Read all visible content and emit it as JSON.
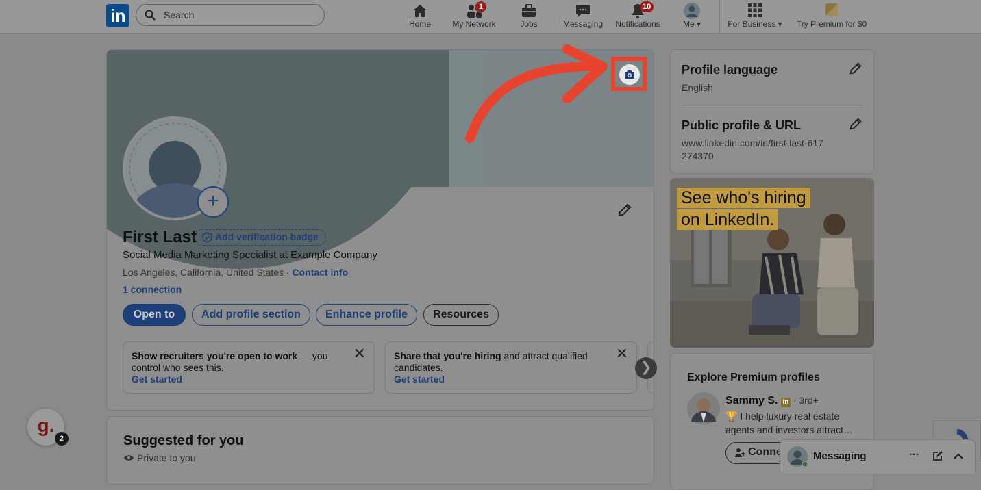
{
  "nav": {
    "logo": "in",
    "search_placeholder": "Search",
    "items": [
      {
        "label": "Home",
        "icon": "home-icon"
      },
      {
        "label": "My Network",
        "icon": "network-icon",
        "badge": "1"
      },
      {
        "label": "Jobs",
        "icon": "briefcase-icon"
      },
      {
        "label": "Messaging",
        "icon": "chat-icon"
      },
      {
        "label": "Notifications",
        "icon": "bell-icon",
        "badge": "10"
      },
      {
        "label": "Me",
        "icon": "avatar-icon"
      },
      {
        "label": "For Business",
        "icon": "grid-icon"
      },
      {
        "label": "Try Premium for $0",
        "icon": "premium-icon"
      }
    ]
  },
  "profile": {
    "name": "First Last",
    "verify_label": "Add verification badge",
    "headline": "Social Media Marketing Specialist at Example Company",
    "location": "Los Angeles, California, United States",
    "location_sep": " · ",
    "contact_info": "Contact info",
    "connections": "1 connection",
    "buttons": {
      "open_to": "Open to",
      "add_section": "Add profile section",
      "enhance": "Enhance profile",
      "resources": "Resources"
    },
    "suggestions": [
      {
        "bold": "Show recruiters you're open to work",
        "rest": " — you control who sees this.",
        "cta": "Get started"
      },
      {
        "bold": "Share that you're hiring",
        "rest": " and attract qualified candidates.",
        "cta": "Get started"
      }
    ],
    "next_arrow": "❯"
  },
  "suggested": {
    "title": "Suggested for you",
    "private": "Private to you"
  },
  "sidebar": {
    "profile_language": {
      "title": "Profile language",
      "value": "English"
    },
    "public_profile": {
      "title": "Public profile & URL",
      "value": "www.linkedin.com/in/first-last-617274370"
    },
    "ad": {
      "line1": "See who's hiring",
      "line2": "on LinkedIn."
    },
    "premium": {
      "title": "Explore Premium profiles",
      "person_name": "Sammy S.",
      "person_degree": " · 3rd+",
      "person_desc": "🏆 I help luxury real estate agents and investors attract…",
      "connect_label": "Conne"
    }
  },
  "widgets": {
    "g_label": "g.",
    "g_badge": "2",
    "messaging_label": "Messaging",
    "more_label": "···"
  },
  "colors": {
    "overlay_gray": "#8a8a8a",
    "accent_blue": "#1e3f77",
    "highlight_red": "#e8432e"
  }
}
